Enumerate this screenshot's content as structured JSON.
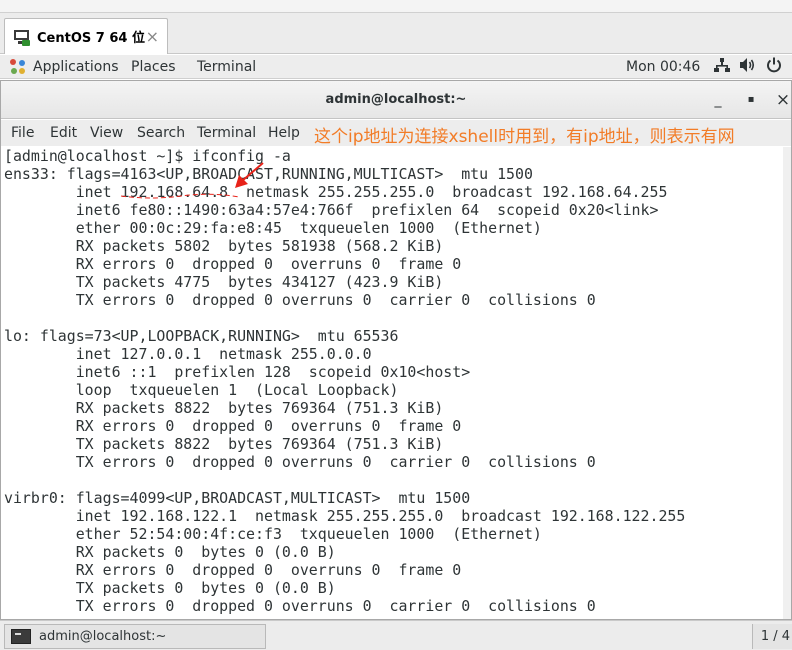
{
  "vm_tab": {
    "title": "CentOS 7 64 位",
    "close": "×"
  },
  "gnome_bar": {
    "applications": "Applications",
    "places": "Places",
    "terminal": "Terminal",
    "clock": "Mon 00:46",
    "tray_icons": [
      "network-icon",
      "volume-icon",
      "power-icon"
    ]
  },
  "window": {
    "title": "admin@localhost:~",
    "minimize": "_",
    "maximize": "▪",
    "close": "×"
  },
  "menu": {
    "file": "File",
    "edit": "Edit",
    "view": "View",
    "search": "Search",
    "terminal": "Terminal",
    "help": "Help"
  },
  "annotation": {
    "text": "这个ip地址为连接xshell时用到，有ip地址，则表示有网",
    "color": "#f27c27"
  },
  "terminal_lines": [
    "[admin@localhost ~]$ ifconfig -a",
    "ens33: flags=4163<UP,BROADCAST,RUNNING,MULTICAST>  mtu 1500",
    "        inet 192.168.64.8  netmask 255.255.255.0  broadcast 192.168.64.255",
    "        inet6 fe80::1490:63a4:57e4:766f  prefixlen 64  scopeid 0x20<link>",
    "        ether 00:0c:29:fa:e8:45  txqueuelen 1000  (Ethernet)",
    "        RX packets 5802  bytes 581938 (568.2 KiB)",
    "        RX errors 0  dropped 0  overruns 0  frame 0",
    "        TX packets 4775  bytes 434127 (423.9 KiB)",
    "        TX errors 0  dropped 0 overruns 0  carrier 0  collisions 0",
    "",
    "lo: flags=73<UP,LOOPBACK,RUNNING>  mtu 65536",
    "        inet 127.0.0.1  netmask 255.0.0.0",
    "        inet6 ::1  prefixlen 128  scopeid 0x10<host>",
    "        loop  txqueuelen 1  (Local Loopback)",
    "        RX packets 8822  bytes 769364 (751.3 KiB)",
    "        RX errors 0  dropped 0  overruns 0  frame 0",
    "        TX packets 8822  bytes 769364 (751.3 KiB)",
    "        TX errors 0  dropped 0 overruns 0  carrier 0  collisions 0",
    "",
    "virbr0: flags=4099<UP,BROADCAST,MULTICAST>  mtu 1500",
    "        inet 192.168.122.1  netmask 255.255.255.0  broadcast 192.168.122.255",
    "        ether 52:54:00:4f:ce:f3  txqueuelen 1000  (Ethernet)",
    "        RX packets 0  bytes 0 (0.0 B)",
    "        RX errors 0  dropped 0  overruns 0  frame 0",
    "        TX packets 0  bytes 0 (0.0 B)",
    "        TX errors 0  dropped 0 overruns 0  carrier 0  collisions 0"
  ],
  "taskbar": {
    "task_label": "admin@localhost:~",
    "pager": "1 / 4"
  },
  "colors": {
    "annotation": "#f27c27",
    "arrow": "#e8231a",
    "underline": "#e8231a"
  }
}
